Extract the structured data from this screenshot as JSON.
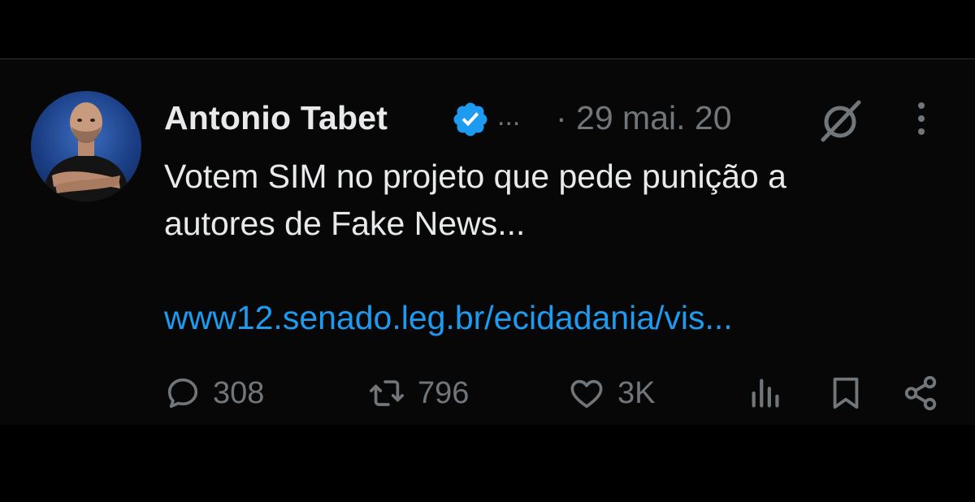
{
  "tweet": {
    "author_name": "Antonio Tabet",
    "header_ellipsis": "...",
    "date": "· 29 mai. 20",
    "text_line1": "Votem SIM no projeto que pede punição a",
    "text_line2": "autores de Fake News...",
    "link": "www12.senado.leg.br/ecidadania/vis..."
  },
  "actions": {
    "replies": "308",
    "retweets": "796",
    "likes": "3K"
  },
  "colors": {
    "background": "#000000",
    "text": "#e7e9ea",
    "secondary": "#71767b",
    "link": "#1d9bf0",
    "verified": "#1d9bf0"
  },
  "icons": {
    "verified": "verified-badge-icon",
    "grok": "grok-icon",
    "more": "more-vertical-icon",
    "reply": "reply-icon",
    "retweet": "retweet-icon",
    "like": "heart-icon",
    "views": "views-chart-icon",
    "bookmark": "bookmark-icon",
    "share": "share-icon"
  }
}
